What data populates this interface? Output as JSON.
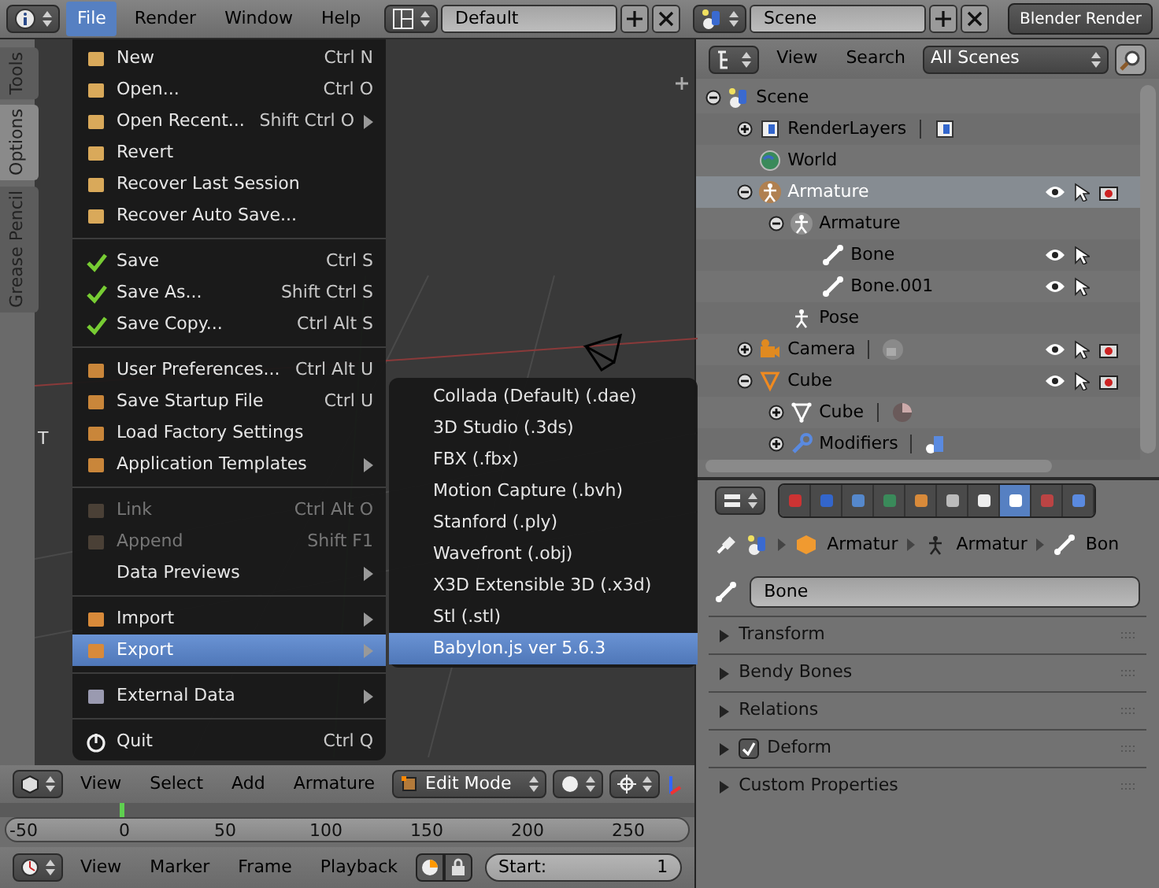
{
  "top_bar": {
    "menus": [
      {
        "label": "File",
        "selected": true
      },
      {
        "label": "Render",
        "selected": false
      },
      {
        "label": "Window",
        "selected": false
      },
      {
        "label": "Help",
        "selected": false
      }
    ],
    "layout": "Default",
    "scene": "Scene",
    "engine": "Blender Render"
  },
  "tool_shelf": {
    "tabs": [
      {
        "label": "Tools",
        "selected": false
      },
      {
        "label": "Options",
        "selected": true
      },
      {
        "label": "Grease Pencil",
        "selected": false
      }
    ],
    "collapsed_label": "T"
  },
  "file_menu": {
    "sections": [
      [
        {
          "label": "New",
          "shortcut": "Ctrl N",
          "submenu": false,
          "disabled": false,
          "selected": false
        },
        {
          "label": "Open...",
          "shortcut": "Ctrl O",
          "submenu": false,
          "disabled": false,
          "selected": false
        },
        {
          "label": "Open Recent...",
          "shortcut": "Shift Ctrl O",
          "submenu": true,
          "disabled": false,
          "selected": false
        },
        {
          "label": "Revert",
          "submenu": false,
          "disabled": false,
          "selected": false
        },
        {
          "label": "Recover Last Session",
          "submenu": false,
          "disabled": false,
          "selected": false
        },
        {
          "label": "Recover Auto Save...",
          "submenu": false,
          "disabled": false,
          "selected": false
        }
      ],
      [
        {
          "label": "Save",
          "shortcut": "Ctrl S",
          "submenu": false,
          "disabled": false,
          "selected": false
        },
        {
          "label": "Save As...",
          "shortcut": "Shift Ctrl S",
          "submenu": false,
          "disabled": false,
          "selected": false
        },
        {
          "label": "Save Copy...",
          "shortcut": "Ctrl Alt S",
          "submenu": false,
          "disabled": false,
          "selected": false
        }
      ],
      [
        {
          "label": "User Preferences...",
          "shortcut": "Ctrl Alt U",
          "submenu": false,
          "disabled": false,
          "selected": false
        },
        {
          "label": "Save Startup File",
          "shortcut": "Ctrl U",
          "submenu": false,
          "disabled": false,
          "selected": false
        },
        {
          "label": "Load Factory Settings",
          "submenu": false,
          "disabled": false,
          "selected": false
        },
        {
          "label": "Application Templates",
          "submenu": true,
          "disabled": false,
          "selected": false
        }
      ],
      [
        {
          "label": "Link",
          "shortcut": "Ctrl Alt O",
          "submenu": false,
          "disabled": true,
          "selected": false
        },
        {
          "label": "Append",
          "shortcut": "Shift F1",
          "submenu": false,
          "disabled": true,
          "selected": false
        },
        {
          "label": "Data Previews",
          "submenu": true,
          "disabled": false,
          "selected": false
        }
      ],
      [
        {
          "label": "Import",
          "submenu": true,
          "disabled": false,
          "selected": false
        },
        {
          "label": "Export",
          "submenu": true,
          "disabled": false,
          "selected": true
        }
      ],
      [
        {
          "label": "External Data",
          "submenu": true,
          "disabled": false,
          "selected": false
        }
      ],
      [
        {
          "label": "Quit",
          "shortcut": "Ctrl Q",
          "submenu": false,
          "disabled": false,
          "selected": false
        }
      ]
    ]
  },
  "export_menu": {
    "items": [
      {
        "label": "Collada (Default) (.dae)",
        "selected": false
      },
      {
        "label": "3D Studio (.3ds)",
        "selected": false
      },
      {
        "label": "FBX (.fbx)",
        "selected": false
      },
      {
        "label": "Motion Capture (.bvh)",
        "selected": false
      },
      {
        "label": "Stanford (.ply)",
        "selected": false
      },
      {
        "label": "Wavefront (.obj)",
        "selected": false
      },
      {
        "label": "X3D Extensible 3D (.x3d)",
        "selected": false
      },
      {
        "label": "Stl (.stl)",
        "selected": false
      },
      {
        "label": "Babylon.js ver 5.6.3",
        "selected": true
      }
    ]
  },
  "view3d_header": {
    "menus": [
      "View",
      "Select",
      "Add",
      "Armature"
    ],
    "mode": "Edit Mode"
  },
  "timeline": {
    "ruler_labels": [
      "-50",
      "0",
      "50",
      "100",
      "150",
      "200",
      "250"
    ]
  },
  "timeline_header": {
    "menus": [
      "View",
      "Marker",
      "Frame",
      "Playback"
    ],
    "start_label": "Start:",
    "start_value": "1"
  },
  "outliner": {
    "menus": [
      "View",
      "Search"
    ],
    "filter": "All Scenes",
    "tree": [
      {
        "label": "Scene",
        "kind": "scene",
        "expanded": true,
        "selected": false,
        "children": [
          {
            "label": "RenderLayers",
            "kind": "renderlayers",
            "expanded": false,
            "selected": false
          },
          {
            "label": "World",
            "kind": "world",
            "selected": false
          },
          {
            "label": "Armature",
            "kind": "armature_object",
            "expanded": true,
            "selected": true,
            "children": [
              {
                "label": "Armature",
                "kind": "armature_data",
                "expanded": true,
                "selected": false,
                "children": [
                  {
                    "label": "Bone",
                    "kind": "bone",
                    "selected": false
                  },
                  {
                    "label": "Bone.001",
                    "kind": "bone",
                    "selected": false
                  }
                ]
              },
              {
                "label": "Pose",
                "kind": "pose",
                "selected": false
              }
            ]
          },
          {
            "label": "Camera",
            "kind": "camera_object",
            "expanded": false,
            "selected": false
          },
          {
            "label": "Cube",
            "kind": "mesh_object",
            "expanded": true,
            "selected": false,
            "children": [
              {
                "label": "Cube",
                "kind": "mesh_data",
                "expanded": false,
                "selected": false
              },
              {
                "label": "Modifiers",
                "kind": "modifiers",
                "expanded": false,
                "selected": false
              }
            ]
          }
        ]
      }
    ]
  },
  "properties": {
    "tabs": [
      {
        "selected": false
      },
      {
        "selected": false
      },
      {
        "selected": false
      },
      {
        "selected": false
      },
      {
        "selected": false
      },
      {
        "selected": false
      },
      {
        "selected": false
      },
      {
        "selected": true
      },
      {
        "selected": false
      },
      {
        "selected": false
      }
    ],
    "breadcrumb": [
      "Armatur",
      "Armatur",
      "Bon"
    ],
    "name_field": "Bone",
    "panels": [
      {
        "label": "Transform",
        "expanded": false
      },
      {
        "label": "Bendy Bones",
        "expanded": false
      },
      {
        "label": "Relations",
        "expanded": false
      },
      {
        "label": "Deform",
        "expanded": false,
        "checked": true
      },
      {
        "label": "Custom Properties",
        "expanded": false
      }
    ]
  }
}
